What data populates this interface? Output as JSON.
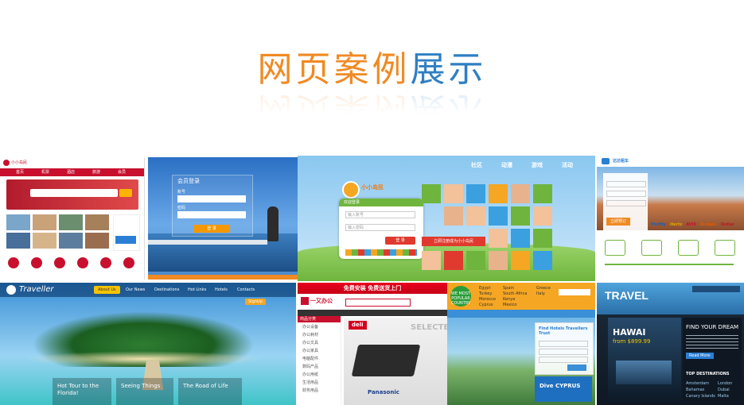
{
  "title": {
    "part1": "网页案例",
    "part2": "展示"
  },
  "colors": {
    "title_orange": "#f08a24",
    "title_blue": "#2f7fc3"
  },
  "tiles": {
    "t1": {
      "brand": "小小岛民",
      "nav": [
        "首页",
        "机票",
        "酒店",
        "旅游",
        "会员"
      ]
    },
    "t2": {
      "heading": "会员登录",
      "label_user": "账号",
      "label_pass": "密码",
      "button": "登 录"
    },
    "t3": {
      "logo": "小小岛民",
      "nav": [
        "社区",
        "动漫",
        "游戏",
        "活动"
      ],
      "login_title": "欢迎登录",
      "user_placeholder": "输入账号",
      "pass_placeholder": "输入密码",
      "login_button": "登 录",
      "register_banner": "立即注册成为小小岛民"
    },
    "t4": {
      "logo": "达达租车",
      "button": "立即预订",
      "brands": [
        "Thrifty",
        "Hertz",
        "AVIS",
        "Budget",
        "Dollar"
      ]
    },
    "t5": {
      "logo": "Traveller",
      "nav": [
        "About Us",
        "Our News",
        "Destinations",
        "Hot Links",
        "Hotels",
        "Contacts"
      ],
      "signup": "SignUp",
      "cards": [
        "Hot Tour to the Florida!",
        "Seeing Things",
        "The Road of Life"
      ]
    },
    "t6": {
      "banner": "免费安装 免费送货上门",
      "logo": "一又办公",
      "menu_title": "商品分类",
      "menu_items": [
        "办公设备",
        "办公耗材",
        "办公文具",
        "办公家具",
        "电脑配件",
        "数码产品",
        "办公用纸",
        "生活用品",
        "财务用品"
      ],
      "promo": "SELECTED",
      "brand": "deli",
      "brand2": "Panasonic"
    },
    "t7": {
      "badge": "WE MOST POPULAR COUNTRY",
      "search_title": "Find Hotels Travellers Trust",
      "promo": "Dive CYPRUS",
      "countries": [
        "Egypt",
        "Turkey",
        "Morocco",
        "Cyprus",
        "Spain",
        "South Africa",
        "Kenya",
        "Mexico",
        "Greece",
        "Italy"
      ]
    },
    "t8": {
      "logo": "TRAVEL",
      "headline": "FIND YOUR DREAM",
      "place": "HAWAI",
      "price": "from $899.99",
      "readmore": "Read More",
      "section": "TOP DESTINATIONS",
      "cities": [
        "Amsterdam",
        "Bahamas",
        "Canary Islands",
        "London",
        "Dubai",
        "Malta"
      ]
    }
  }
}
